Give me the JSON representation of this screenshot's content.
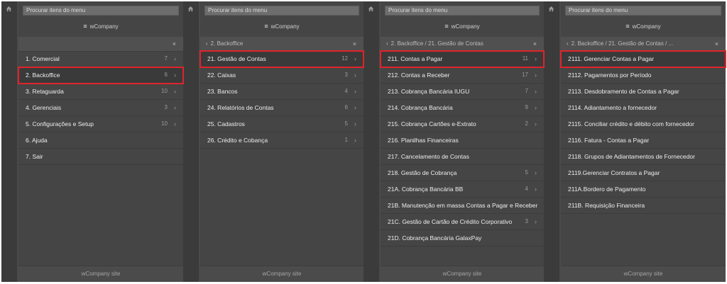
{
  "footer_label": "wCompany site",
  "brand_label": "wCompany",
  "search_placeholder": "Procurar itens do menu",
  "highlight_color": "#e0232b",
  "panels": [
    {
      "breadcrumb": "",
      "items": [
        {
          "label": "1. Comercial",
          "count": "7"
        },
        {
          "label": "2. Backoffice",
          "count": "6"
        },
        {
          "label": "3. Retaguarda",
          "count": "10"
        },
        {
          "label": "4. Gerenciais",
          "count": "3"
        },
        {
          "label": "5. Configurações e Setup",
          "count": "10"
        },
        {
          "label": "6. Ajuda",
          "count": ""
        },
        {
          "label": "7. Sair",
          "count": ""
        }
      ]
    },
    {
      "breadcrumb": "2. Backoffice",
      "items": [
        {
          "label": "21. Gestão de Contas",
          "count": "12"
        },
        {
          "label": "22. Caixas",
          "count": "3"
        },
        {
          "label": "23. Bancos",
          "count": "4"
        },
        {
          "label": "24. Relatórios de Contas",
          "count": "6"
        },
        {
          "label": "25. Cadastros",
          "count": "5"
        },
        {
          "label": "26. Crédito e Cobança",
          "count": "1"
        }
      ]
    },
    {
      "breadcrumb": "2. Backoffice / 21. Gestão de Contas",
      "items": [
        {
          "label": "211. Contas a Pagar",
          "count": "11"
        },
        {
          "label": "212. Contas a Receber",
          "count": "17"
        },
        {
          "label": "213. Cobrança Bancária IUGU",
          "count": "7"
        },
        {
          "label": "214. Cobrança Bancária",
          "count": "9"
        },
        {
          "label": "215. Cobrança Cartões e-Extrato",
          "count": "2"
        },
        {
          "label": "216. Planilhas Financeiras",
          "count": ""
        },
        {
          "label": "217. Cancelamento de Contas",
          "count": ""
        },
        {
          "label": "218. Gestão de Cobrança",
          "count": "5"
        },
        {
          "label": "21A. Cobrança Bancária BB",
          "count": "4"
        },
        {
          "label": "21B. Manutenção em massa Contas a Pagar e Receber",
          "count": ""
        },
        {
          "label": "21C. Gestão de Cartão de Crédito Corporativo",
          "count": "3"
        },
        {
          "label": "21D. Cobrança Bancária GalaxPay",
          "count": ""
        }
      ]
    },
    {
      "breadcrumb": "2. Backoffice / 21. Gestão de Contas / ...",
      "items": [
        {
          "label": "2111. Gerenciar Contas a Pagar",
          "count": ""
        },
        {
          "label": "2112. Pagamentos por Período",
          "count": ""
        },
        {
          "label": "2113. Desdobramento de Contas a Pagar",
          "count": ""
        },
        {
          "label": "2114. Adiantamento a fornecedor",
          "count": ""
        },
        {
          "label": "2115. Conciliar crédito e débito com fornecedor",
          "count": ""
        },
        {
          "label": "2116. Fatura - Contas a Pagar",
          "count": ""
        },
        {
          "label": "2118. Grupos de Adiantamentos de Fornecedor",
          "count": ""
        },
        {
          "label": "2119.Gerenciar Contratos a Pagar",
          "count": ""
        },
        {
          "label": "211A.Bordero de Pagamento",
          "count": ""
        },
        {
          "label": "211B. Requisição Financeira",
          "count": ""
        }
      ]
    }
  ]
}
